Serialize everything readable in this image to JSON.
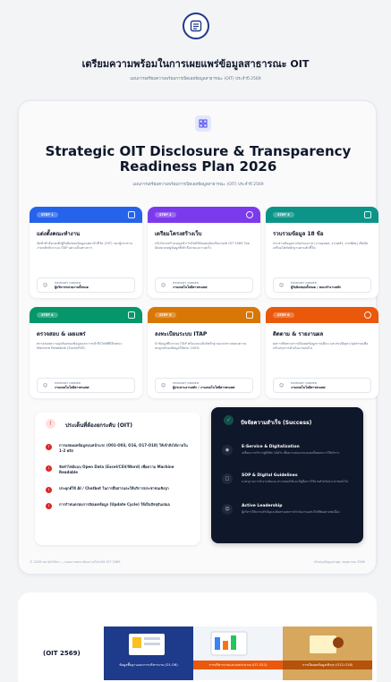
{
  "header": {
    "title": "เตรียมความพร้อมในการเผยแพร่ข้อมูลสาธารณะ OIT",
    "subtitle": "แผนการเตรียมความพร้อมการเปิดเผยข้อมูลสาธารณะ (OIT) ประจำปี 2569"
  },
  "hero": {
    "title": "Strategic OIT Disclosure & Transparency Readiness Plan 2026",
    "subtitle": "แผนการเตรียมความพร้อมการเปิดเผยข้อมูลสาธารณะ (OIT) ประจำปี 2569"
  },
  "steps": [
    {
      "pill": "STEP 1",
      "title": "แต่งตั้งคณะทำงาน",
      "desc": "จัดทำคำสั่งแต่งตั้งผู้รับผิดชอบข้อมูลแต่ละตัวชี้วัด (OIT) และผู้ประสานงานหลักกับระบบ ITAP อย่างเป็นทางการ",
      "owner_label": "PRIMARY OWNER",
      "owner": "ผู้บริหารหน่วยงานทั้งหมด",
      "color": "#2563eb",
      "icon": "users-icon"
    },
    {
      "pill": "STEP 2",
      "title": "เตรียมโครงสร้างเว็บ",
      "desc": "ปรับโครงสร้างเมนูหน้าเว็บไซต์ให้สอดคล้องกับเกณฑ์ OIT 2569 โดยจัดหมวดหมู่ข้อมูลที่เข้าถึงง่ายและรวดเร็ว",
      "owner_label": "PRIMARY OWNER",
      "owner": "งานเทคโนโลยีสารสนเทศ",
      "color": "#7c3aed",
      "icon": "globe-icon"
    },
    {
      "pill": "STEP 3",
      "title": "รวบรวมข้อมูล 18 ข้อ",
      "desc": "ประสานข้อมูลจากทุกกองงาน (งานบุคคล, งานคลัง, งานพัสดุ) เพื่อจัดเตรียมไฟล์หลักฐานตามตัวชี้วัด",
      "owner_label": "PRIMARY OWNER",
      "owner": "ผู้รับผิดชอบทั้งหมด / คณะทำงานหลัก",
      "color": "#0d9488",
      "icon": "document-icon"
    },
    {
      "pill": "STEP 4",
      "title": "ตรวจสอบ & เผยแพร่",
      "desc": "ตรวจสอบความถูกต้องของข้อมูลและการเข้าถึงไฟล์ที่มีลักษณะ Machine Readable (Excel/PDF)",
      "owner_label": "PRIMARY OWNER",
      "owner": "งานเทคโนโลยีสารสนเทศ",
      "color": "#059669",
      "icon": "upload-icon"
    },
    {
      "pill": "STEP 5",
      "title": "ลงทะเบียนระบบ ITAP",
      "desc": "นำข้อมูลขึ้นระบบ ITAP พร้อมแนบลิงก์หลักฐานและตรวจสอบความสมบูรณ์ของข้อมูลให้ครบ 100%",
      "owner_label": "PRIMARY OWNER",
      "owner": "ผู้ประสานงานหลัก / งานเทคโนโลยีสารสนเทศ",
      "color": "#d97706",
      "icon": "database-icon"
    },
    {
      "pill": "STEP 6",
      "title": "ติดตาม & รายงานผล",
      "desc": "ผลการติดตามการเปิดเผยข้อมูลรายเดือน และสรุปปัญหา/อุปสรรคเพื่อปรับปรุงการดำเนินงานต่อไป",
      "owner_label": "PRIMARY OWNER",
      "owner": "งานเทคโนโลยีสารสนเทศ",
      "color": "#ea580c",
      "icon": "refresh-icon"
    }
  ],
  "issues": {
    "title": "ประเด็นที่ต้องยกระดับ (OIT)",
    "items": [
      "การแสดงผลข้อมูลบนหน้าแรก (O01-O03, O16, O17-O18) ให้เข้าถึงได้ภายใน 1-2 คลิก",
      "จัดทำไฟล์แบบ Open Data (Excel/CSV/Word) เพื่อความ Machine Readable",
      "ประยุกต์ใช้ AI / Chatbot ในการสื่อสารและให้บริการประชาชนเชิงรุก",
      "การกำหนดรอบการอัปเดตข้อมูล (Update Cycle) ให้เป็นปัจจุบันเสมอ"
    ]
  },
  "success": {
    "title": "ปัจจัยความสำเร็จ (Success)",
    "items": [
      {
        "name": "E-Service & Digitalization",
        "desc": "เปลี่ยนการบริการสู่ดิจิทัล 100% เพื่อความสะดวกและลดขั้นตอนการให้บริการ",
        "icon": "globe-icon"
      },
      {
        "name": "SOP & Digital Guidelines",
        "desc": "มาตรฐานการทำงานชัดเจน ตรวจสอบได้และมีคู่มือการใช้งานสำหรับประชาชนทั่วไป",
        "icon": "document-icon"
      },
      {
        "name": "Active Leadership",
        "desc": "ผู้บริหารให้ความสำคัญและติดตามผลการดำเนินงานอย่างใกล้ชิดอย่างต่อเนื่อง",
        "icon": "users-icon"
      }
    ]
  },
  "footer": {
    "left": "© 2026 สถาบันวิจัยฯ — แผนการยกระดับความโปร่งใส OIT 2569",
    "right": "ปรับปรุงข้อมูลล่าสุด: พฤษภาคม 2569"
  },
  "lower": {
    "label": "(OIT 2569)",
    "banners": [
      {
        "caption": "ข้อมูลพื้นฐานและการบริหารงาน (O1-O6)",
        "bg": "#1e3a8a"
      },
      {
        "caption": "การบริหารงานและงบประมาณ (O7-O11)",
        "bg": "#ea580c"
      },
      {
        "caption": "การเปิดเผยข้อมูลเชิงรุก (O12-O18)",
        "bg": "#b45309"
      }
    ]
  }
}
